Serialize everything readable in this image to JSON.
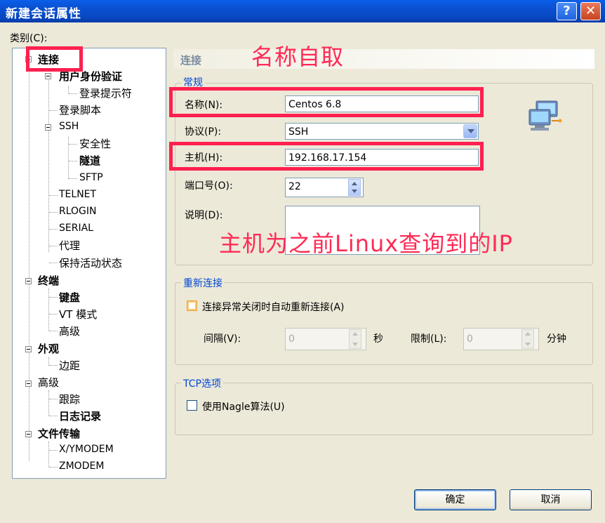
{
  "window": {
    "title": "新建会话属性",
    "help_label": "?",
    "close_label": "✕"
  },
  "category_label": "类别(C):",
  "tree": [
    {
      "label": "连接",
      "bold": true
    },
    {
      "label": "用户身份验证",
      "bold": true
    },
    {
      "label": "登录提示符",
      "bold": false
    },
    {
      "label": "登录脚本",
      "bold": false
    },
    {
      "label": "SSH",
      "bold": false
    },
    {
      "label": "安全性",
      "bold": false
    },
    {
      "label": "隧道",
      "bold": true
    },
    {
      "label": "SFTP",
      "bold": false
    },
    {
      "label": "TELNET",
      "bold": false
    },
    {
      "label": "RLOGIN",
      "bold": false
    },
    {
      "label": "SERIAL",
      "bold": false
    },
    {
      "label": "代理",
      "bold": false
    },
    {
      "label": "保持活动状态",
      "bold": false
    },
    {
      "label": "终端",
      "bold": true
    },
    {
      "label": "键盘",
      "bold": true
    },
    {
      "label": "VT 模式",
      "bold": false
    },
    {
      "label": "高级",
      "bold": false
    },
    {
      "label": "外观",
      "bold": true
    },
    {
      "label": "边距",
      "bold": false
    },
    {
      "label": "高级",
      "bold": false
    },
    {
      "label": "跟踪",
      "bold": false
    },
    {
      "label": "日志记录",
      "bold": true
    },
    {
      "label": "文件传输",
      "bold": true
    },
    {
      "label": "X/YMODEM",
      "bold": false
    },
    {
      "label": "ZMODEM",
      "bold": false
    }
  ],
  "panel": {
    "header": "连接",
    "general_legend": "常规",
    "name_label": "名称(N):",
    "name_value": "Centos 6.8",
    "protocol_label": "协议(P):",
    "protocol_value": "SSH",
    "host_label": "主机(H):",
    "host_value": "192.168.17.154",
    "port_label": "端口号(O):",
    "port_value": "22",
    "desc_label": "说明(D):",
    "desc_value": ""
  },
  "reconnect": {
    "legend": "重新连接",
    "checkbox_label": "连接异常关闭时自动重新连接(A)",
    "interval_label": "间隔(V):",
    "interval_value": "0",
    "interval_unit": "秒",
    "limit_label": "限制(L):",
    "limit_value": "0",
    "limit_unit": "分钟"
  },
  "tcp": {
    "legend": "TCP选项",
    "nagle_label": "使用Nagle算法(U)"
  },
  "buttons": {
    "ok": "确定",
    "cancel": "取消"
  },
  "annotations": {
    "name_note": "名称自取",
    "host_note": "主机为之前Linux查询到的IP"
  },
  "colors": {
    "annotation_red": "#ff2050",
    "legend_blue": "#0046d5"
  }
}
